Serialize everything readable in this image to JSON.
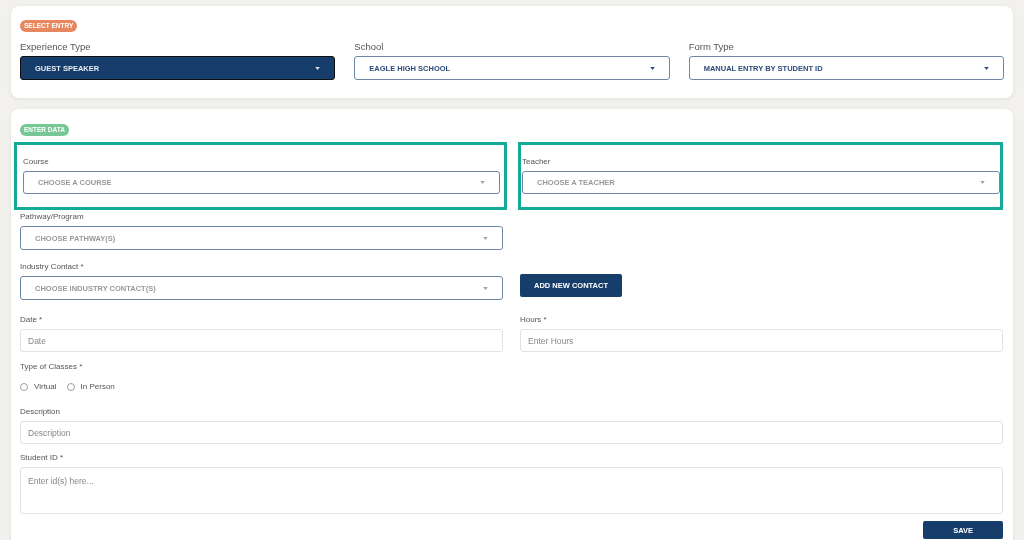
{
  "select_entry": {
    "badge": "SELECT ENTRY",
    "fields": [
      {
        "label": "Experience Type",
        "value": "GUEST SPEAKER",
        "active": true
      },
      {
        "label": "School",
        "value": "EAGLE HIGH SCHOOL",
        "active": false
      },
      {
        "label": "Form Type",
        "value": "MANUAL ENTRY BY STUDENT ID",
        "active": false
      }
    ]
  },
  "enter_data": {
    "badge": "ENTER DATA",
    "course": {
      "label": "Course",
      "placeholder": "CHOOSE A COURSE",
      "highlighted": true
    },
    "teacher": {
      "label": "Teacher",
      "placeholder": "CHOOSE A TEACHER",
      "highlighted": true
    },
    "pathway": {
      "label": "Pathway/Program",
      "placeholder": "CHOOSE PATHWAY(S)"
    },
    "industry_contact": {
      "label": "Industry Contact *",
      "placeholder": "CHOOSE INDUSTRY CONTACT(S)"
    },
    "add_contact_button": "ADD NEW CONTACT",
    "date": {
      "label": "Date *",
      "placeholder": "Date"
    },
    "hours": {
      "label": "Hours *",
      "placeholder": "Enter Hours"
    },
    "type_of_classes": {
      "label": "Type of Classes *",
      "options": [
        {
          "label": "Virtual",
          "checked": false
        },
        {
          "label": "In Person",
          "checked": false
        }
      ]
    },
    "description": {
      "label": "Description",
      "placeholder": "Description"
    },
    "student_id": {
      "label": "Student ID *",
      "placeholder": "Enter id(s) here..."
    },
    "save_button": "SAVE"
  }
}
